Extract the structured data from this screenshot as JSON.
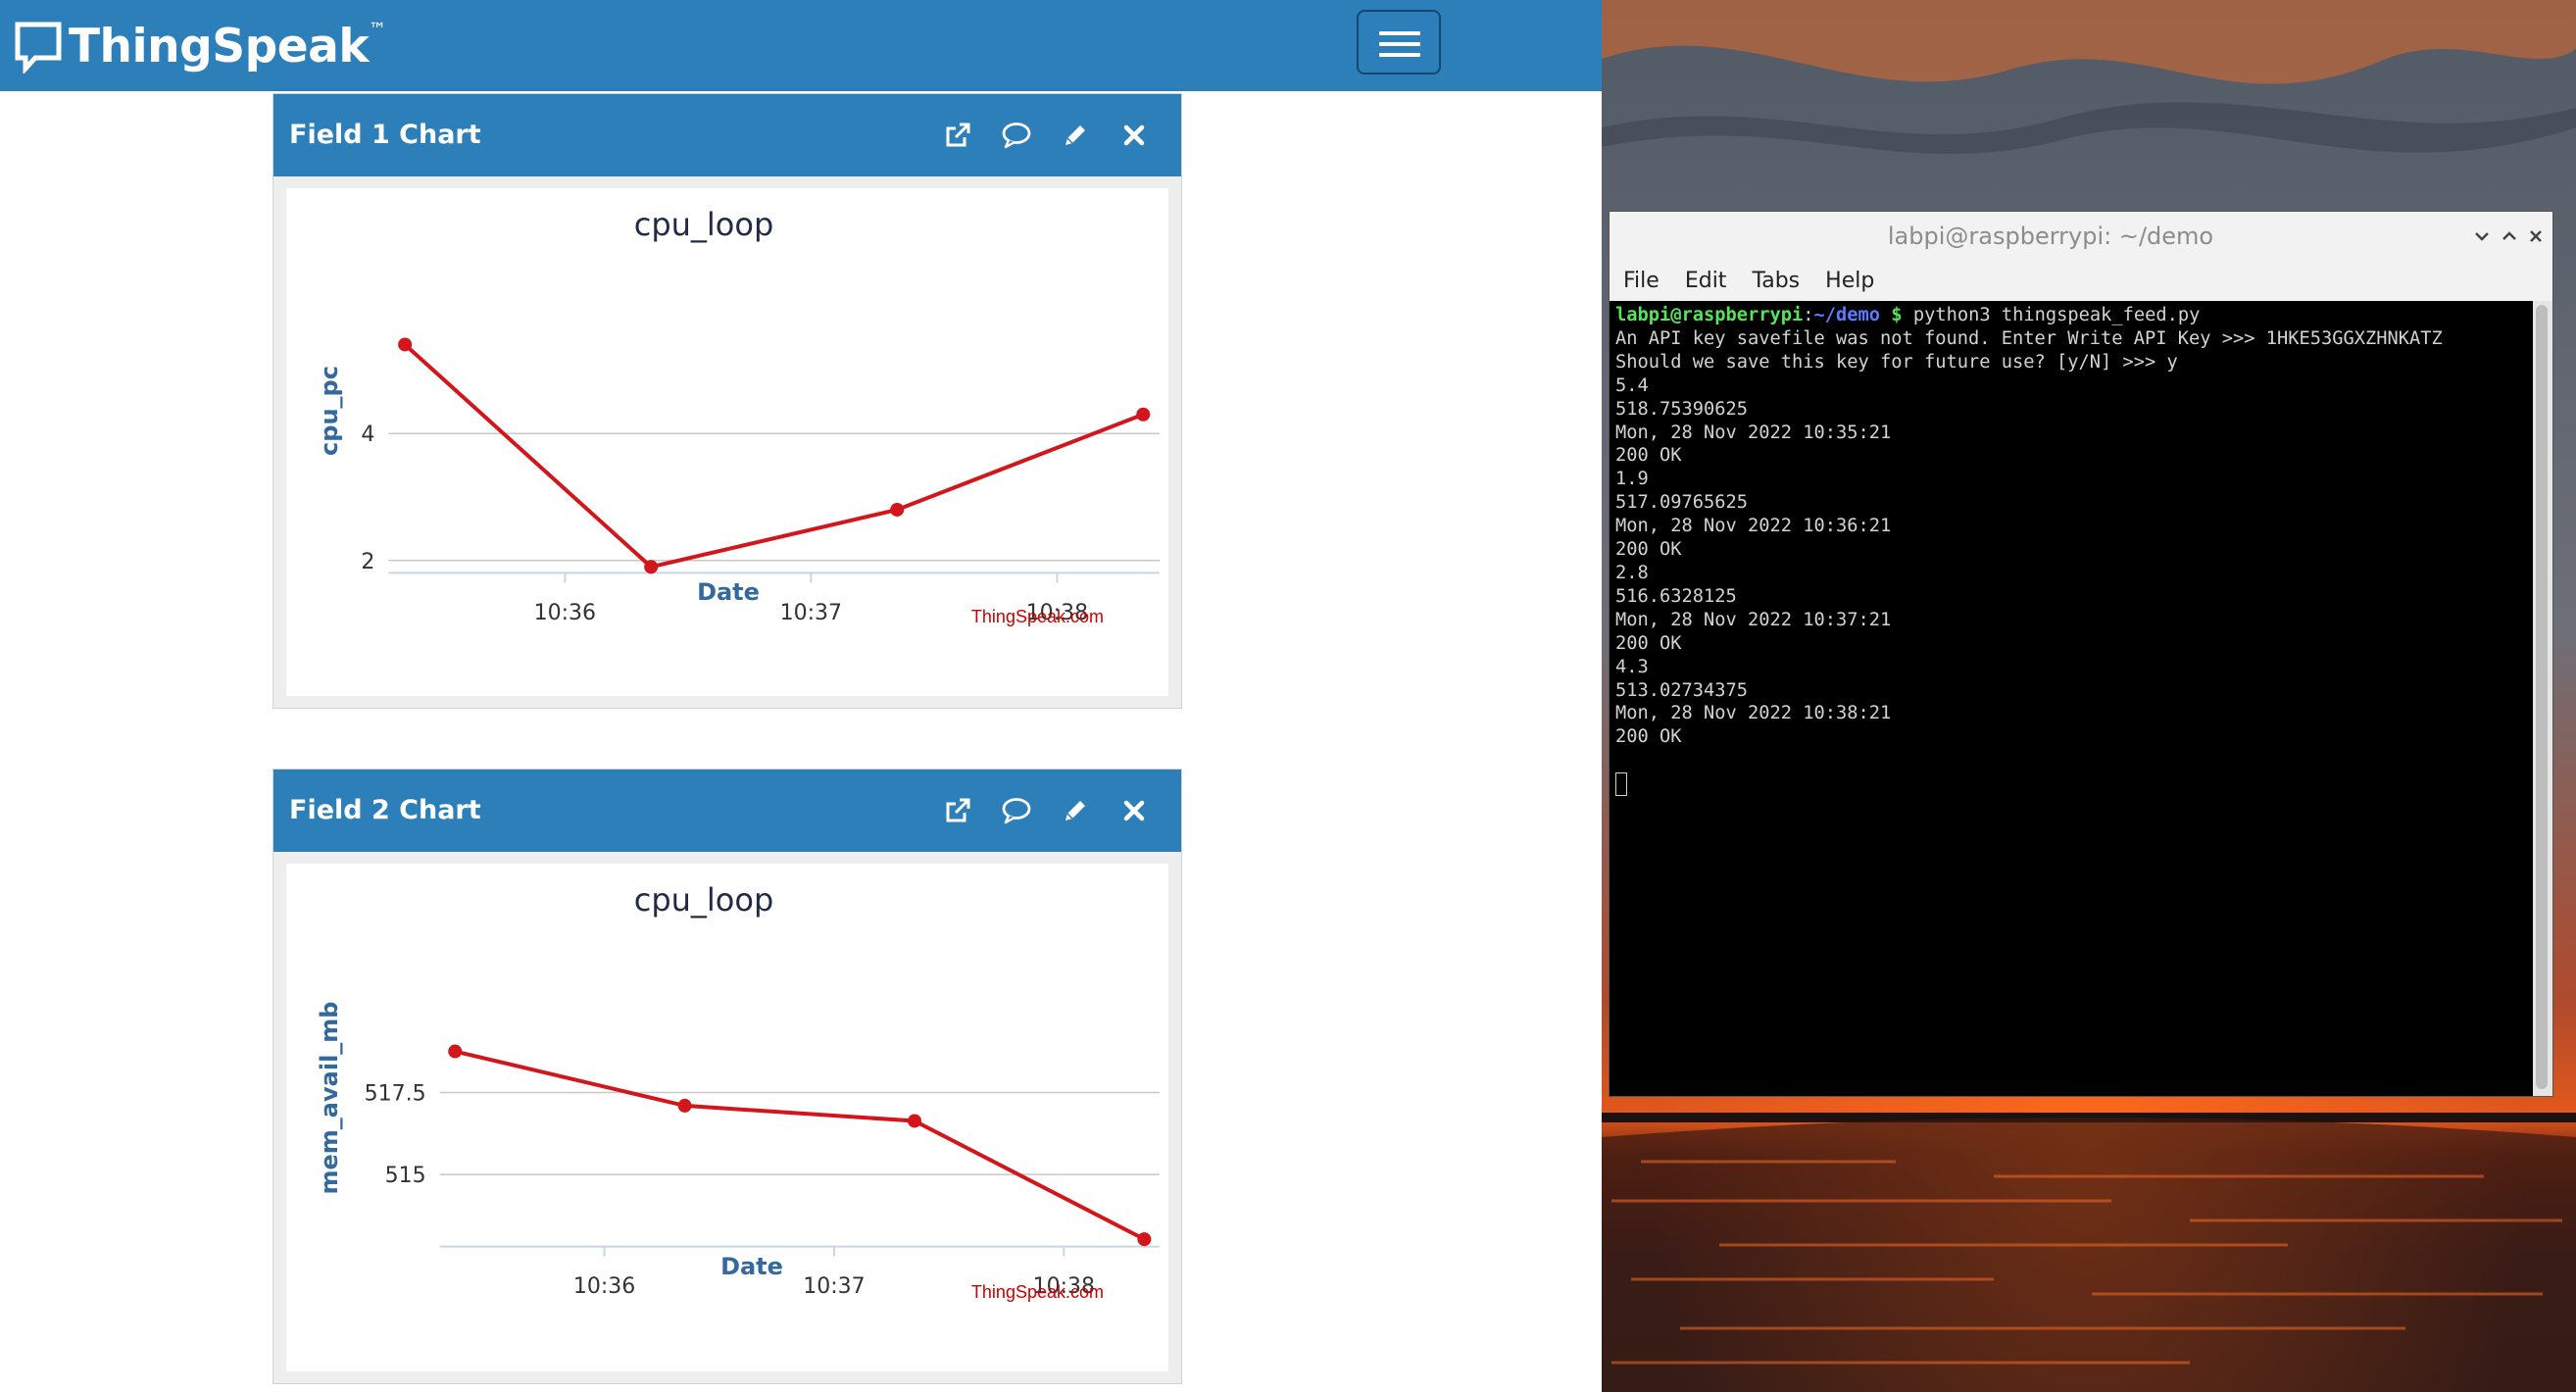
{
  "thingspeak": {
    "brand": "ThingSpeak",
    "brand_tm": "™",
    "panels": [
      {
        "title": "Field 1 Chart",
        "chart_title": "cpu_loop",
        "credit": "ThingSpeak.com",
        "icons": [
          "external-link-icon",
          "comment-icon",
          "pencil-icon",
          "close-icon"
        ]
      },
      {
        "title": "Field 2 Chart",
        "chart_title": "cpu_loop",
        "credit": "ThingSpeak.com",
        "icons": [
          "external-link-icon",
          "comment-icon",
          "pencil-icon",
          "close-icon"
        ]
      }
    ]
  },
  "chart_data": [
    {
      "type": "line",
      "title": "cpu_loop",
      "xlabel": "Date",
      "ylabel": "cpu_pc",
      "x": [
        "10:35:21",
        "10:36:21",
        "10:37:21",
        "10:38:21"
      ],
      "xticks": [
        "10:36",
        "10:37",
        "10:38"
      ],
      "xlim": [
        "10:35:17",
        "10:38:25"
      ],
      "yticks": [
        2,
        4
      ],
      "ylim": [
        1.75,
        6.25
      ],
      "series": [
        {
          "values": [
            5.4,
            1.9,
            2.8,
            4.3
          ],
          "color": "#d3151c"
        }
      ],
      "grid": true
    },
    {
      "type": "line",
      "title": "cpu_loop",
      "xlabel": "Date",
      "ylabel": "mem_avail_mb",
      "x": [
        "10:35:21",
        "10:36:21",
        "10:37:21",
        "10:38:21"
      ],
      "xticks": [
        "10:36",
        "10:37",
        "10:38"
      ],
      "xlim": [
        "10:35:17",
        "10:38:25"
      ],
      "yticks": [
        515,
        517.5
      ],
      "ylim": [
        512.75,
        521.25
      ],
      "series": [
        {
          "values": [
            518.75390625,
            517.09765625,
            516.6328125,
            513.02734375
          ],
          "color": "#d3151c"
        }
      ],
      "grid": true
    }
  ],
  "terminal": {
    "title": "labpi@raspberrypi: ~/demo",
    "menu": [
      "File",
      "Edit",
      "Tabs",
      "Help"
    ],
    "prompt_user": "labpi@raspberrypi",
    "prompt_sep": ":",
    "prompt_path": "~/demo",
    "prompt_symbol": " $ ",
    "command": "python3 thingspeak_feed.py",
    "output": [
      "An API key savefile was not found. Enter Write API Key >>> 1HKE53GGXZHNKATZ",
      "Should we save this key for future use? [y/N] >>> y",
      "5.4",
      "518.75390625",
      "Mon, 28 Nov 2022 10:35:21",
      "200 OK",
      "1.9",
      "517.09765625",
      "Mon, 28 Nov 2022 10:36:21",
      "200 OK",
      "2.8",
      "516.6328125",
      "Mon, 28 Nov 2022 10:37:21",
      "200 OK",
      "4.3",
      "513.02734375",
      "Mon, 28 Nov 2022 10:38:21",
      "200 OK"
    ]
  }
}
